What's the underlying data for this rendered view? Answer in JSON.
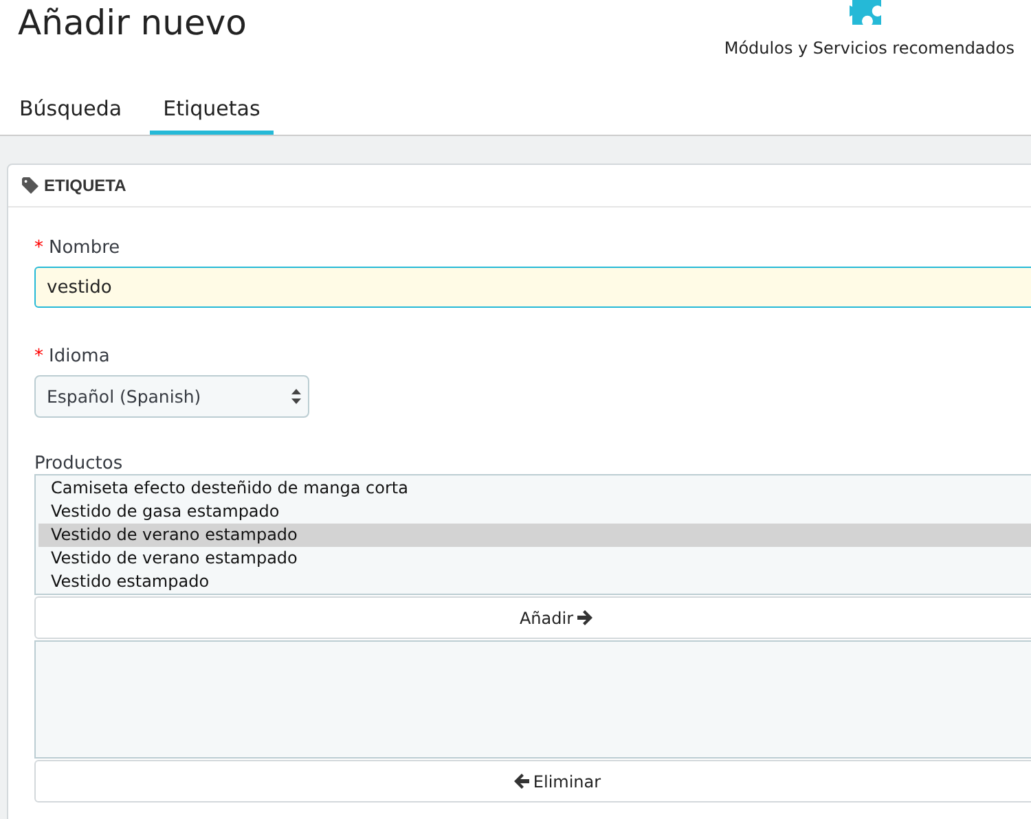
{
  "page_title": "Añadir nuevo",
  "toolbar_link": "Módulos y Servicios recomendados",
  "tabs": [
    {
      "label": "Búsqueda",
      "selected": false
    },
    {
      "label": "Etiquetas",
      "selected": true
    }
  ],
  "panel": {
    "heading": "ETIQUETA",
    "name_field": {
      "required_mark": "*",
      "label": "Nombre",
      "value": "vestido"
    },
    "language_field": {
      "required_mark": "*",
      "label": "Idioma",
      "value": "Español (Spanish)"
    },
    "products": {
      "label": "Productos",
      "items": [
        {
          "label": "Camiseta efecto desteñido de manga corta",
          "selected": false
        },
        {
          "label": "Vestido de gasa estampado",
          "selected": false
        },
        {
          "label": "Vestido de verano estampado",
          "selected": true
        },
        {
          "label": "Vestido de verano estampado",
          "selected": false
        },
        {
          "label": "Vestido estampado",
          "selected": false
        }
      ],
      "add_button": "Añadir",
      "remove_button": "Eliminar"
    }
  }
}
